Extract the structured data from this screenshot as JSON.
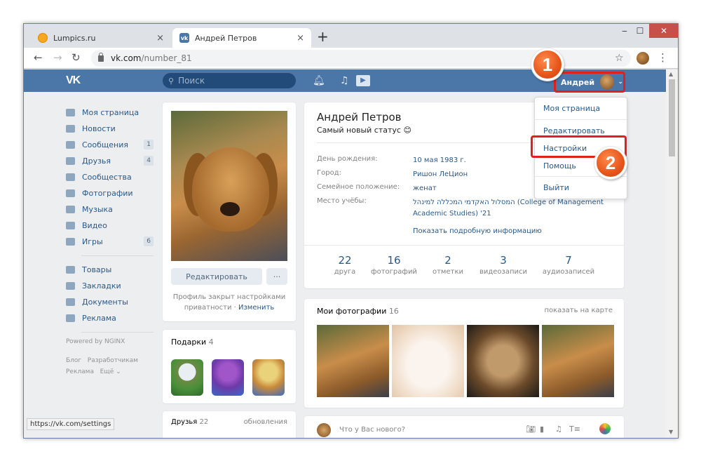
{
  "browser": {
    "tabs": [
      {
        "title": "Lumpics.ru",
        "close": "×"
      },
      {
        "title": "Андрей Петров",
        "close": "×"
      }
    ],
    "new_tab": "+",
    "controls": {
      "minimize": "‒",
      "maximize": "☐",
      "close": "✕"
    },
    "url_host": "vk.com",
    "url_path": "/number_81",
    "status_url": "https://vk.com/settings"
  },
  "vk": {
    "logo": "VK",
    "search_placeholder": "Поиск",
    "user_name": "Андрей",
    "left_menu": [
      {
        "label": "Моя страница",
        "badge": ""
      },
      {
        "label": "Новости",
        "badge": ""
      },
      {
        "label": "Сообщения",
        "badge": "1"
      },
      {
        "label": "Друзья",
        "badge": "4"
      },
      {
        "label": "Сообщества",
        "badge": ""
      },
      {
        "label": "Фотографии",
        "badge": ""
      },
      {
        "label": "Музыка",
        "badge": ""
      },
      {
        "label": "Видео",
        "badge": ""
      },
      {
        "label": "Игры",
        "badge": "6"
      }
    ],
    "left_menu2": [
      "Товары",
      "Закладки",
      "Документы",
      "Реклама"
    ],
    "powered": "Powered by NGINX",
    "footer_links": [
      "Блог",
      "Разработчикам",
      "Реклама",
      "Ещё ⌄"
    ],
    "profile": {
      "edit_button": "Редактировать",
      "more_button": "···",
      "privacy_text": "Профиль закрыт настройками приватности ·",
      "privacy_link": "Изменить",
      "name": "Андрей Петров",
      "status": "Самый новый статус 😊",
      "info": [
        {
          "label": "День рождения:",
          "value": "10 мая 1983 г."
        },
        {
          "label": "Город:",
          "value": "Ришон ЛеЦион"
        },
        {
          "label": "Семейное положение:",
          "value": "женат"
        },
        {
          "label": "Место учёбы:",
          "value": "המסלול האקדמי המכללה למינהל (College of Management Academic Studies) '21"
        }
      ],
      "show_more": "Показать подробную информацию",
      "counters": [
        {
          "n": "22",
          "l": "друга"
        },
        {
          "n": "16",
          "l": "фотографий"
        },
        {
          "n": "2",
          "l": "отметки"
        },
        {
          "n": "3",
          "l": "видеозаписи"
        },
        {
          "n": "7",
          "l": "аудиозаписей"
        }
      ]
    },
    "gifts": {
      "title": "Подарки",
      "count": "4"
    },
    "friends": {
      "title": "Друзья",
      "count": "22",
      "link": "обновления"
    },
    "photos": {
      "title": "Мои фотографии",
      "count": "16",
      "link": "показать на карте"
    },
    "post_placeholder": "Что у Вас нового?",
    "dropdown": [
      "Моя страница",
      "Редактировать",
      "Настройки",
      "Помощь",
      "Выйти"
    ]
  },
  "annotations": {
    "step1": "1",
    "step2": "2",
    "color": "#e0201b"
  }
}
